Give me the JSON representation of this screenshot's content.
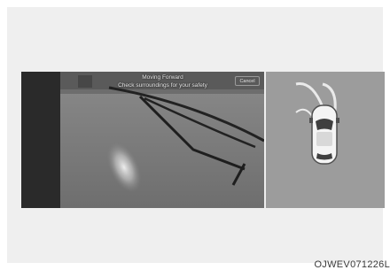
{
  "camera_screen": {
    "message_line1": "Moving Forward",
    "message_line2": "Check surroundings for your safety",
    "cancel_label": "Cancel"
  },
  "figure_code": "OJWEV071226L",
  "colors": {
    "screen_bg": "#3a3a3a",
    "floor": "#7f7f7f",
    "top_view_bg": "#9c9c9c",
    "guide_line": "#1e1e1e",
    "car_body": "#f2f2f2"
  },
  "icons": {
    "car": "car-top-view-icon",
    "sensors": "parking-sensor-arc-icon"
  }
}
